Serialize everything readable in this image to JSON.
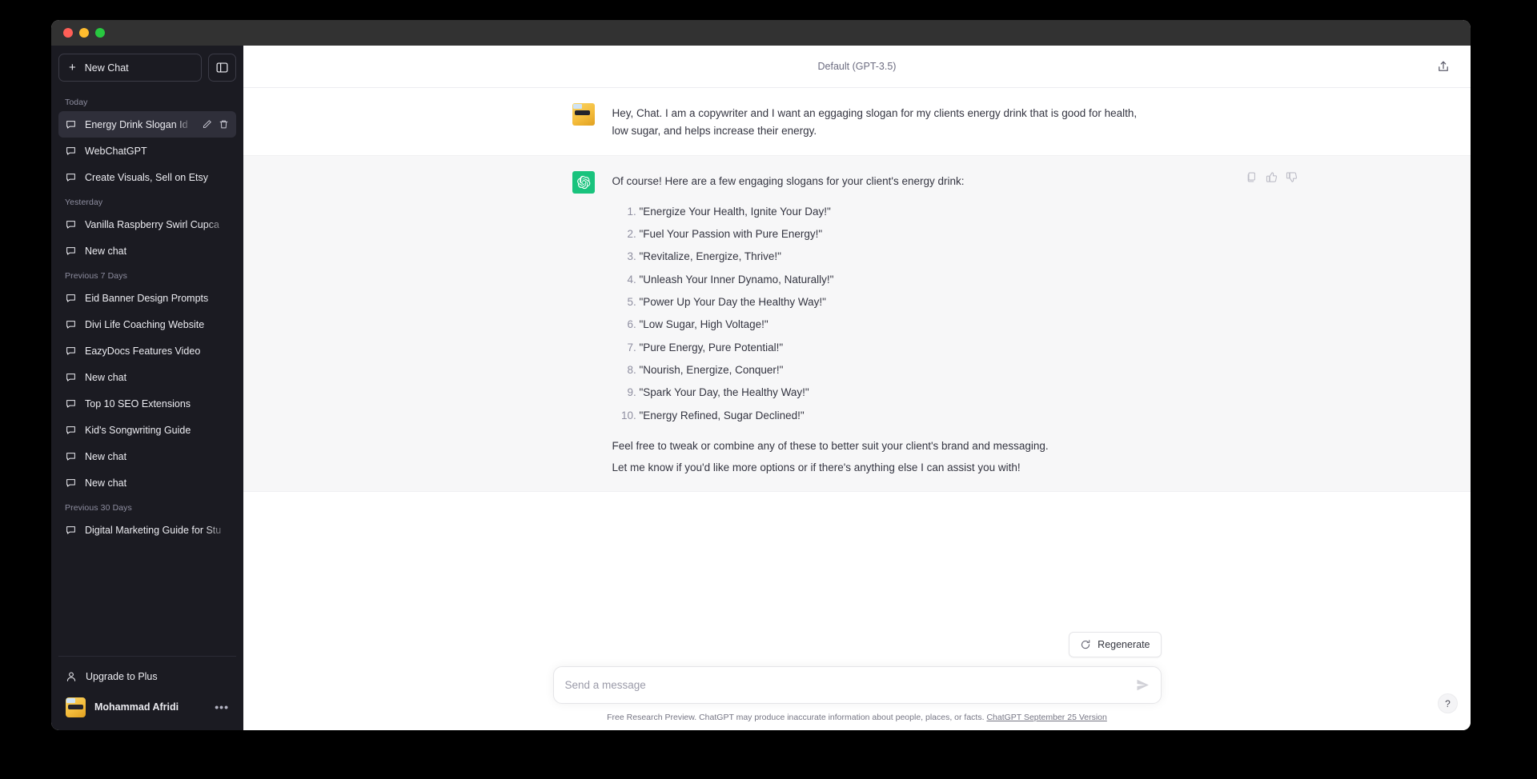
{
  "window": {
    "traffic_lights": [
      "close",
      "minimize",
      "maximize"
    ]
  },
  "sidebar": {
    "new_chat_label": "New Chat",
    "collapse_icon": "sidebar-toggle-icon",
    "sections": [
      {
        "label": "Today",
        "items": [
          {
            "title": "Energy Drink Slogan Id",
            "active": true
          },
          {
            "title": "WebChatGPT",
            "active": false
          },
          {
            "title": "Create Visuals, Sell on Etsy",
            "active": false
          }
        ]
      },
      {
        "label": "Yesterday",
        "items": [
          {
            "title": "Vanilla Raspberry Swirl Cupca",
            "active": false
          },
          {
            "title": "New chat",
            "active": false
          }
        ]
      },
      {
        "label": "Previous 7 Days",
        "items": [
          {
            "title": "Eid Banner Design Prompts",
            "active": false
          },
          {
            "title": "Divi Life Coaching Website",
            "active": false
          },
          {
            "title": "EazyDocs Features Video",
            "active": false
          },
          {
            "title": "New chat",
            "active": false
          },
          {
            "title": "Top 10 SEO Extensions",
            "active": false
          },
          {
            "title": "Kid's Songwriting Guide",
            "active": false
          },
          {
            "title": "New chat",
            "active": false
          },
          {
            "title": "New chat",
            "active": false
          }
        ]
      },
      {
        "label": "Previous 30 Days",
        "items": [
          {
            "title": "Digital Marketing Guide for Stu",
            "active": false
          }
        ]
      }
    ],
    "upgrade_label": "Upgrade to Plus",
    "user_name": "Mohammad Afridi"
  },
  "header": {
    "model": "Default (GPT-3.5)",
    "share_icon": "share-upload-icon"
  },
  "conversation": {
    "user_message": "Hey, Chat. I am a copywriter and I want an eggaging slogan for my clients energy drink that is good for health, low sugar, and helps increase their energy.",
    "assistant_intro": "Of course! Here are a few engaging slogans for your client's energy drink:",
    "slogans": [
      "\"Energize Your Health, Ignite Your Day!\"",
      "\"Fuel Your Passion with Pure Energy!\"",
      "\"Revitalize, Energize, Thrive!\"",
      "\"Unleash Your Inner Dynamo, Naturally!\"",
      "\"Power Up Your Day the Healthy Way!\"",
      "\"Low Sugar, High Voltage!\"",
      "\"Pure Energy, Pure Potential!\"",
      "\"Nourish, Energize, Conquer!\"",
      "\"Spark Your Day, the Healthy Way!\"",
      "\"Energy Refined, Sugar Declined!\""
    ],
    "assistant_closing_1": "Feel free to tweak or combine any of these to better suit your client's brand and messaging.",
    "assistant_closing_2": "Let me know if you'd like more options or if there's anything else I can assist you with!",
    "actions": [
      "copy-icon",
      "thumbs-up-icon",
      "thumbs-down-icon"
    ]
  },
  "composer": {
    "regenerate_label": "Regenerate",
    "input_placeholder": "Send a message",
    "input_value": "",
    "send_icon": "send-arrow-icon"
  },
  "footer": {
    "disclaimer_text": "Free Research Preview. ChatGPT may produce inaccurate information about people, places, or facts.",
    "version_link": "ChatGPT September 25 Version",
    "help_label": "?"
  },
  "colors": {
    "sidebar_bg": "#1b1b22",
    "active_item": "#2f2f3a",
    "assistant_bg": "#f7f7f8",
    "bot_avatar": "#19c37d",
    "titlebar": "#323232"
  }
}
